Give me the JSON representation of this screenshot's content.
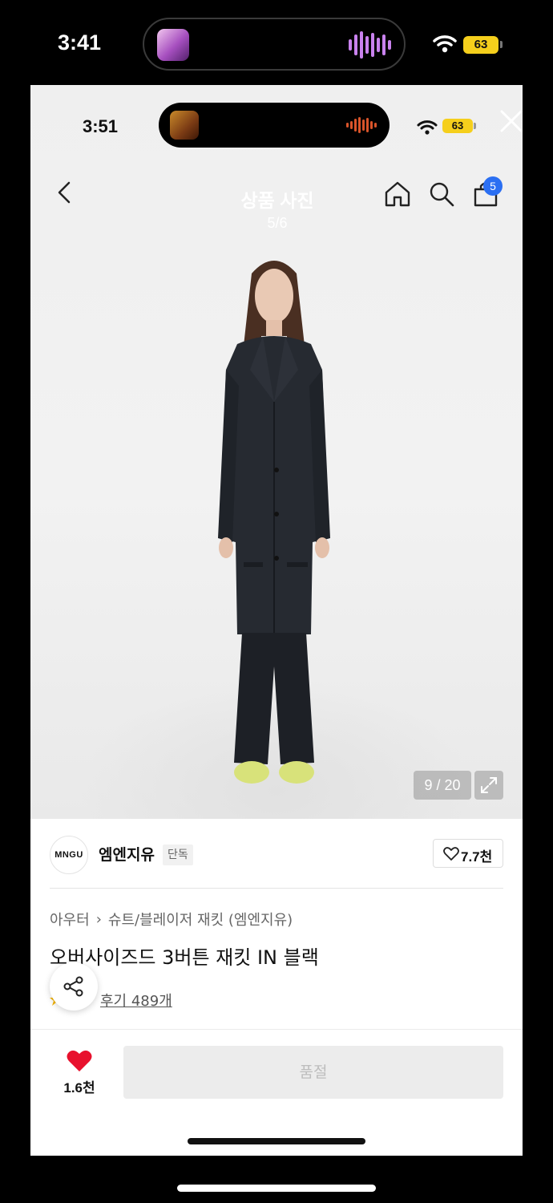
{
  "outer_status": {
    "time": "3:41",
    "battery": "63"
  },
  "inner_status": {
    "time": "3:51",
    "battery": "63"
  },
  "viewer": {
    "title": "상품 사진",
    "counter": "5/6"
  },
  "nav": {
    "cart_badge": "5"
  },
  "image": {
    "counter": "9 / 20"
  },
  "brand": {
    "logo_text": "MNGU",
    "name": "엠엔지유",
    "tag": "단독",
    "like_count": "7.7천"
  },
  "breadcrumb": {
    "category": "아우터",
    "separator": "›",
    "subcategory": "슈트/블레이저 재킷 (엠엔지유)"
  },
  "product": {
    "title": "오버사이즈드 3버튼 재킷 IN 블랙",
    "reviews": "후기 489개"
  },
  "bottom_bar": {
    "wish_count": "1.6천",
    "button_label": "품절"
  },
  "colors": {
    "accent_blue": "#2b6ff2",
    "heart_red": "#e8112d",
    "battery_yellow": "#f5cf1c"
  }
}
